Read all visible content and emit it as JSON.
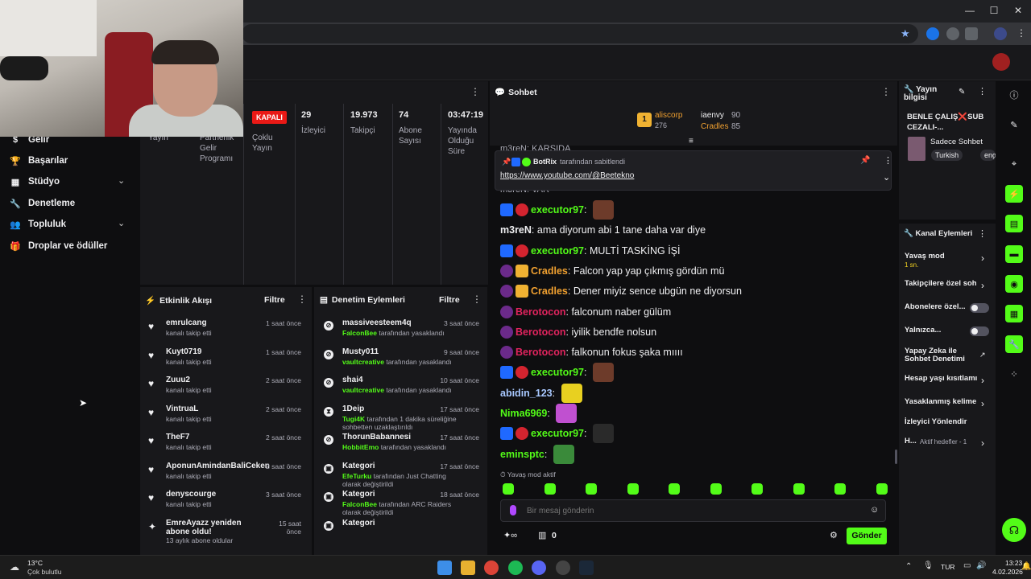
{
  "browser": {
    "controls": [
      "—",
      "☐",
      "✕"
    ]
  },
  "leftnav": {
    "items": [
      {
        "label": "Gelir",
        "icon": "dollar-icon"
      },
      {
        "label": "Başarılar",
        "icon": "trophy-icon"
      },
      {
        "label": "Stüdyo",
        "icon": "studio-icon",
        "expandable": true
      },
      {
        "label": "Denetleme",
        "icon": "wrench-icon"
      },
      {
        "label": "Topluluk",
        "icon": "people-icon",
        "expandable": true
      },
      {
        "label": "Droplar ve ödüller",
        "icon": "gift-icon"
      }
    ]
  },
  "stats": {
    "partial_labels": [
      "Yayın",
      "Partnerlik\nGelir\nProgramı"
    ],
    "status_badge": "KAPALI",
    "cols": [
      {
        "value": "",
        "label": "Çoklu\nYayın"
      },
      {
        "value": "29",
        "label": "İzleyici"
      },
      {
        "value": "19.973",
        "label": "Takipçi"
      },
      {
        "value": "74",
        "label": "Abone\nSayısı"
      },
      {
        "value": "03:47:19",
        "label": "Yayında\nOlduğu\nSüre"
      }
    ]
  },
  "activity": {
    "title": "Etkinlik Akışı",
    "filter": "Filtre",
    "items": [
      {
        "name": "emrulcang",
        "sub": "kanalı takip etti",
        "time": "1 saat önce"
      },
      {
        "name": "Kuyt0719",
        "sub": "kanalı takip etti",
        "time": "1 saat önce"
      },
      {
        "name": "Zuuu2",
        "sub": "kanalı takip etti",
        "time": "2 saat önce"
      },
      {
        "name": "VintruaL",
        "sub": "kanalı takip etti",
        "time": "2 saat önce"
      },
      {
        "name": "TheF7",
        "sub": "kanalı takip etti",
        "time": "2 saat önce"
      },
      {
        "name": "AponunAmindanBaliCeken",
        "sub": "kanalı takip etti",
        "time": "2 saat önce"
      },
      {
        "name": "denyscourge",
        "sub": "kanalı takip etti",
        "time": "3 saat önce"
      },
      {
        "name": "EmreAyazz yeniden abone oldu!",
        "sub": "13 aylık abone oldular",
        "time": "15 saat önce"
      }
    ]
  },
  "moderation": {
    "title": "Denetim Eylemleri",
    "filter": "Filtre",
    "items": [
      {
        "name": "massiveesteem4q",
        "actor": "FalconBee",
        "sub": " tarafından yasaklandı",
        "time": "3 saat önce"
      },
      {
        "name": "Musty011",
        "actor": "vaultcreative",
        "sub": " tarafından yasaklandı",
        "time": "9 saat önce"
      },
      {
        "name": "shai4",
        "actor": "vaultcreative",
        "sub": " tarafından yasaklandı",
        "time": "10 saat önce"
      },
      {
        "name": "1Deip",
        "actor": "Tugi4K",
        "sub": " tarafından 1 dakika süreliğine sohbetten uzaklaştırıldı",
        "time": "17 saat önce"
      },
      {
        "name": "ThorunBabannesi",
        "actor": "HobbitEmo",
        "sub": " tarafından yasaklandı",
        "time": "17 saat önce"
      },
      {
        "name": "Kategori",
        "actor": "EfeTurku",
        "sub": " tarafından Just Chatting olarak değiştirildi",
        "time": "17 saat önce"
      },
      {
        "name": "Kategori",
        "actor": "FalconBee",
        "sub": " tarafından ARC Raiders olarak değiştirildi",
        "time": "18 saat önce"
      },
      {
        "name": "Kategori",
        "actor": "",
        "sub": "",
        "time": ""
      }
    ]
  },
  "chat": {
    "title": "Sohbet",
    "leaderboard": [
      {
        "rank": "1",
        "name": "aliscorp",
        "points": "276"
      },
      {
        "name": "iaenvy",
        "points": "90"
      },
      {
        "name": "Cradles",
        "points": "85"
      }
    ],
    "pinned": {
      "by": "BotRix",
      "by_suffix": "tarafından sabitlendi",
      "link": "https://www.youtube.com/@Beetekno"
    },
    "partial_top": "m3reN: KARŞIDA",
    "partial_second": "m3reN: VAR",
    "messages": [
      {
        "user": "executor97",
        "color": "#53fc18",
        "badges": [
          "blue",
          "red"
        ],
        "text": "",
        "emote": "#6d3b2a"
      },
      {
        "user": "m3reN",
        "color": "#efeff1",
        "badges": [],
        "text": "ama diyorum abi 1 tane daha var diye",
        "emote": ""
      },
      {
        "user": "executor97",
        "color": "#53fc18",
        "badges": [
          "blue",
          "red"
        ],
        "text": "MULTİ TASKİNG İŞİ",
        "emote": ""
      },
      {
        "user": "Cradles",
        "color": "#f0a030",
        "badges": [
          "purple",
          "gift"
        ],
        "text": "Falcon yap yap çıkmış gördün mü",
        "emote": ""
      },
      {
        "user": "Cradles",
        "color": "#f0a030",
        "badges": [
          "purple",
          "gift"
        ],
        "text": "Dener miyiz sence ubgün ne diyorsun",
        "emote": ""
      },
      {
        "user": "Berotocon",
        "color": "#e0245e",
        "badges": [
          "purple"
        ],
        "text": "falconum naber gülüm",
        "emote": ""
      },
      {
        "user": "Berotocon",
        "color": "#e0245e",
        "badges": [
          "purple"
        ],
        "text": "iyilik bendfe nolsun",
        "emote": ""
      },
      {
        "user": "Berotocon",
        "color": "#e0245e",
        "badges": [
          "purple"
        ],
        "text": "falkonun fokus şaka mıııı",
        "emote": ""
      },
      {
        "user": "executor97",
        "color": "#53fc18",
        "badges": [
          "blue",
          "red"
        ],
        "text": "",
        "emote": "#6d3b2a"
      },
      {
        "user": "abidin_123",
        "color": "#a8c8ff",
        "badges": [],
        "text": "",
        "emote": "#e8d020"
      },
      {
        "user": "Nima6969",
        "color": "#53fc18",
        "badges": [],
        "text": "",
        "emote": "#c050d0"
      },
      {
        "user": "executor97",
        "color": "#53fc18",
        "badges": [
          "blue",
          "red"
        ],
        "text": "",
        "emote": "#2a2a2a"
      },
      {
        "user": "eminsptc",
        "color": "#53fc18",
        "badges": [],
        "text": "",
        "emote": "#3a8a3a"
      }
    ],
    "slow_mode": "Yavaş mod aktif",
    "input_placeholder": "Bir mesaj gönderin",
    "points_count": "0",
    "send_label": "Gönder"
  },
  "stream_info": {
    "title": "Yayın bilgisi",
    "stream_title": "BENLE ÇALIŞ❌SUB CEZALI-...",
    "category": "Sadece Sohbet",
    "tags": [
      "Turkish",
      "eng"
    ]
  },
  "channel_actions": {
    "title": "Kanal Eylemleri",
    "items": [
      {
        "label": "Yavaş mod",
        "sub": "1 sn.",
        "control": "arrow"
      },
      {
        "label": "Takipçilere özel soh",
        "control": "arrow"
      },
      {
        "label": "Abonelere özel...",
        "control": "toggle"
      },
      {
        "label": "Yalnızca...",
        "control": "toggle"
      },
      {
        "label": "Yapay Zeka ile Sohbet Denetimi",
        "control": "external"
      },
      {
        "label": "Hesap yaşı kısıtlamı",
        "control": "arrow"
      },
      {
        "label": "Yasaklanmış kelime",
        "control": "arrow"
      },
      {
        "label": "İzleyici Yönlendir",
        "control": "none"
      },
      {
        "label": "H...",
        "sub": "Aktif hedefler - 1",
        "control": "arrow"
      }
    ]
  },
  "taskbar": {
    "weather_temp": "13°C",
    "weather_desc": "Çok bulutlu",
    "lang": "TUR",
    "time": "13:23",
    "date": "4.02.2026"
  }
}
